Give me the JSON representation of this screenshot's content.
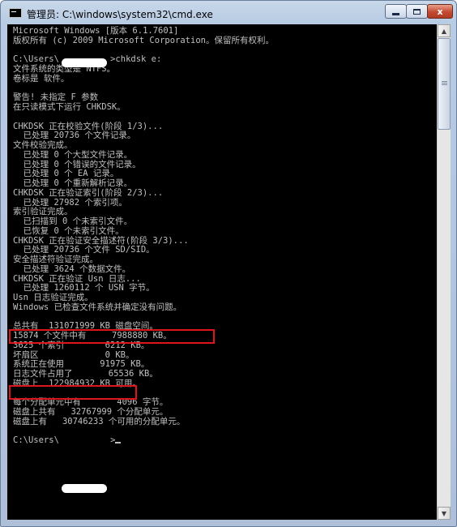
{
  "window": {
    "title": "管理员: C:\\windows\\system32\\cmd.exe",
    "close_glyph": "x"
  },
  "console": {
    "lines": [
      "Microsoft Windows [版本 6.1.7601]",
      "版权所有 (c) 2009 Microsoft Corporation。保留所有权利。",
      "",
      "C:\\Users\\          >chkdsk e:",
      "文件系统的类型是 NTFS。",
      "卷标是 软件。",
      "",
      "警告! 未指定 F 参数",
      "在只读模式下运行 CHKDSK。",
      "",
      "CHKDSK 正在校验文件(阶段 1/3)...",
      "  已处理 20736 个文件记录。",
      "文件校验完成。",
      "  已处理 0 个大型文件记录。",
      "  已处理 0 个错误的文件记录。",
      "  已处理 0 个 EA 记录。",
      "  已处理 0 个重新解析记录。",
      "CHKDSK 正在验证索引(阶段 2/3)...",
      "  已处理 27982 个索引项。",
      "索引验证完成。",
      "  已扫描到 0 个未索引文件。",
      "  已恢复 0 个未索引文件。",
      "CHKDSK 正在验证安全描述符(阶段 3/3)...",
      "  已处理 20736 个文件 SD/SID。",
      "安全描述符验证完成。",
      "  已处理 3624 个数据文件。",
      "CHKDSK 正在验证 Usn 日志...",
      "  已处理 1260112 个 USN 字节。",
      "Usn 日志验证完成。",
      "Windows 已检查文件系统并确定没有问题。",
      "",
      "总共有  131071999 KB 磁盘空间。",
      "15874 个文件中有     7988880 KB。",
      "3625 个索引        6212 KB。",
      "坏扇区             0 KB。",
      "系统正在使用       91975 KB。",
      "日志文件占用了       65536 KB。",
      "磁盘上  122984932 KB 可用。",
      "",
      "每个分配单元中有       4096 字节。",
      "磁盘上共有   32767999 个分配单元。",
      "磁盘上有   30746233 个可用的分配单元。",
      "",
      "C:\\Users\\          >"
    ]
  },
  "scrollbar": {
    "up_glyph": "▲",
    "down_glyph": "▼"
  },
  "colors": {
    "console_bg": "#000000",
    "console_text": "#c0c0c0",
    "highlight_border": "#e0141c"
  }
}
